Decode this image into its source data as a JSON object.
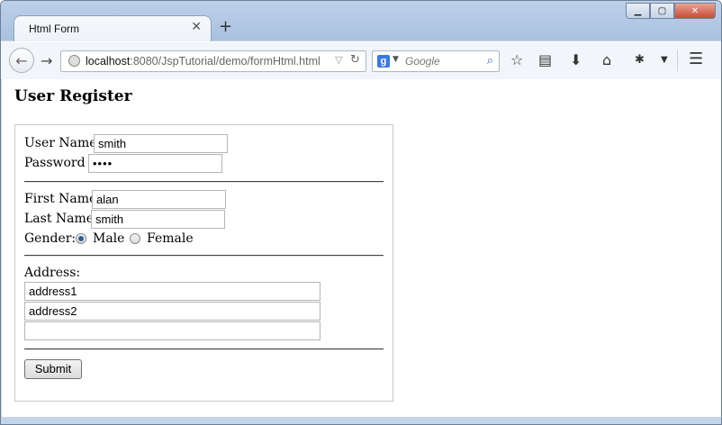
{
  "browser": {
    "tab_title": "Html Form",
    "url_host": "localhost",
    "url_rest": ":8080/JspTutorial/demo/formHtml.html",
    "search_placeholder": "Google"
  },
  "page": {
    "heading": "User Register",
    "form": {
      "user_name_label": "User Name:",
      "user_name_value": "smith",
      "password_label": "Password :",
      "password_value": "••••",
      "first_name_label": "First Name:",
      "first_name_value": "alan",
      "last_name_label": "Last Name:",
      "last_name_value": "smith",
      "gender_label": "Gender:",
      "gender_options": [
        "Male",
        "Female"
      ],
      "gender_selected": "Male",
      "address_label": "Address:",
      "address_lines": [
        "address1",
        "address2",
        ""
      ],
      "submit_label": "Submit"
    }
  },
  "colors": {
    "window_frame": "#c5d6ea",
    "radio_selected": "#2b5f9c"
  }
}
